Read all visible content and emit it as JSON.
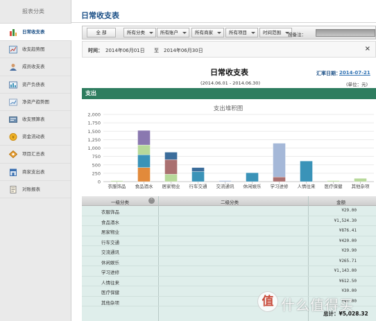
{
  "sidebar": {
    "title": "报表分类",
    "items": [
      {
        "label": "日常收支表",
        "icon": "bar-chart-icon",
        "active": true
      },
      {
        "label": "收支趋势图",
        "icon": "line-chart-icon"
      },
      {
        "label": "成员收支表",
        "icon": "user-icon"
      },
      {
        "label": "资产负债表",
        "icon": "balance-sheet-icon"
      },
      {
        "label": "净资产趋势图",
        "icon": "trend-icon"
      },
      {
        "label": "收支预算表",
        "icon": "budget-icon"
      },
      {
        "label": "资金流动表",
        "icon": "coin-icon"
      },
      {
        "label": "项目汇总表",
        "icon": "project-icon"
      },
      {
        "label": "商家支出表",
        "icon": "shop-icon"
      },
      {
        "label": "对账报表",
        "icon": "document-icon"
      }
    ]
  },
  "header": {
    "title": "日常收支表"
  },
  "toolbar": {
    "all_label": "全 部",
    "filters": [
      "所有分类",
      "所有账户",
      "所有商家",
      "所有项目",
      "时间范围"
    ],
    "notes_label": "按备注："
  },
  "date_strip": {
    "label": "时间：",
    "start": "2014年06月01日",
    "sep": "至",
    "end": "2014年06月30日",
    "close": "×"
  },
  "report": {
    "title": "日常收支表",
    "range": "(2014.06.01 - 2014.06.30)",
    "summary_date_label": "汇率日期：",
    "summary_date": "2014-07-21",
    "unit": "(单位：元)"
  },
  "section": {
    "title": "支出"
  },
  "chart_data": {
    "type": "bar",
    "title": "支出堆积图",
    "categories": [
      "衣服饰品",
      "食品酒水",
      "居家物业",
      "行车交通",
      "交流通讯",
      "休闲娱乐",
      "学习进修",
      "人情往来",
      "医疗保健",
      "其他杂项"
    ],
    "values": [
      29,
      1524.3,
      876.41,
      420,
      29.9,
      265.71,
      1143,
      612.5,
      30,
      97
    ],
    "series": [
      {
        "name": "s1",
        "color": "#e28a3b",
        "values": [
          0,
          420,
          0,
          0,
          0,
          0,
          0,
          0,
          0,
          0
        ]
      },
      {
        "name": "s2",
        "color": "#3a93b8",
        "values": [
          0,
          380,
          0,
          300,
          0,
          265.71,
          0,
          612.5,
          0,
          0
        ]
      },
      {
        "name": "s3",
        "color": "#b7d99a",
        "values": [
          29,
          290,
          220,
          0,
          0,
          0,
          0,
          0,
          30,
          97
        ]
      },
      {
        "name": "s4",
        "color": "#aa7070",
        "values": [
          0,
          0,
          436,
          0,
          0,
          0,
          140,
          0,
          0,
          0
        ]
      },
      {
        "name": "s5",
        "color": "#a5b8d8",
        "values": [
          0,
          0,
          0,
          0,
          29.9,
          0,
          1003,
          0,
          0,
          0
        ]
      },
      {
        "name": "s6",
        "color": "#3b6d9b",
        "values": [
          0,
          0,
          220.41,
          120,
          0,
          0,
          0,
          0,
          0,
          0
        ]
      },
      {
        "name": "s7",
        "color": "#8a78b0",
        "values": [
          0,
          434.3,
          0,
          0,
          0,
          0,
          0,
          0,
          0,
          0
        ]
      }
    ],
    "yticks": [
      "0",
      "250",
      "500",
      "750",
      "1,000",
      "1,250",
      "1,500",
      "1,750",
      "2,000"
    ],
    "ylim": [
      0,
      2000
    ],
    "xlabel": "",
    "ylabel": "",
    "grid": true,
    "legend": "none"
  },
  "table": {
    "headers": [
      "一级分类",
      "二级分类",
      "金额"
    ],
    "sort_icon": "⌃",
    "rows": [
      {
        "category": "衣服饰品",
        "amount": "¥29.00"
      },
      {
        "category": "食品酒水",
        "amount": "¥1,524.30"
      },
      {
        "category": "居家物业",
        "amount": "¥876.41"
      },
      {
        "category": "行车交通",
        "amount": "¥420.00"
      },
      {
        "category": "交流通讯",
        "amount": "¥29.90"
      },
      {
        "category": "休闲娱乐",
        "amount": "¥265.71"
      },
      {
        "category": "学习进修",
        "amount": "¥1,143.00"
      },
      {
        "category": "人情往来",
        "amount": "¥612.50"
      },
      {
        "category": "医疗保健",
        "amount": "¥30.00"
      },
      {
        "category": "其他杂项",
        "amount": "¥97.00"
      }
    ]
  },
  "total": "总计：¥5,028.32",
  "watermark": {
    "badge": "值",
    "text": "什么值得买"
  }
}
